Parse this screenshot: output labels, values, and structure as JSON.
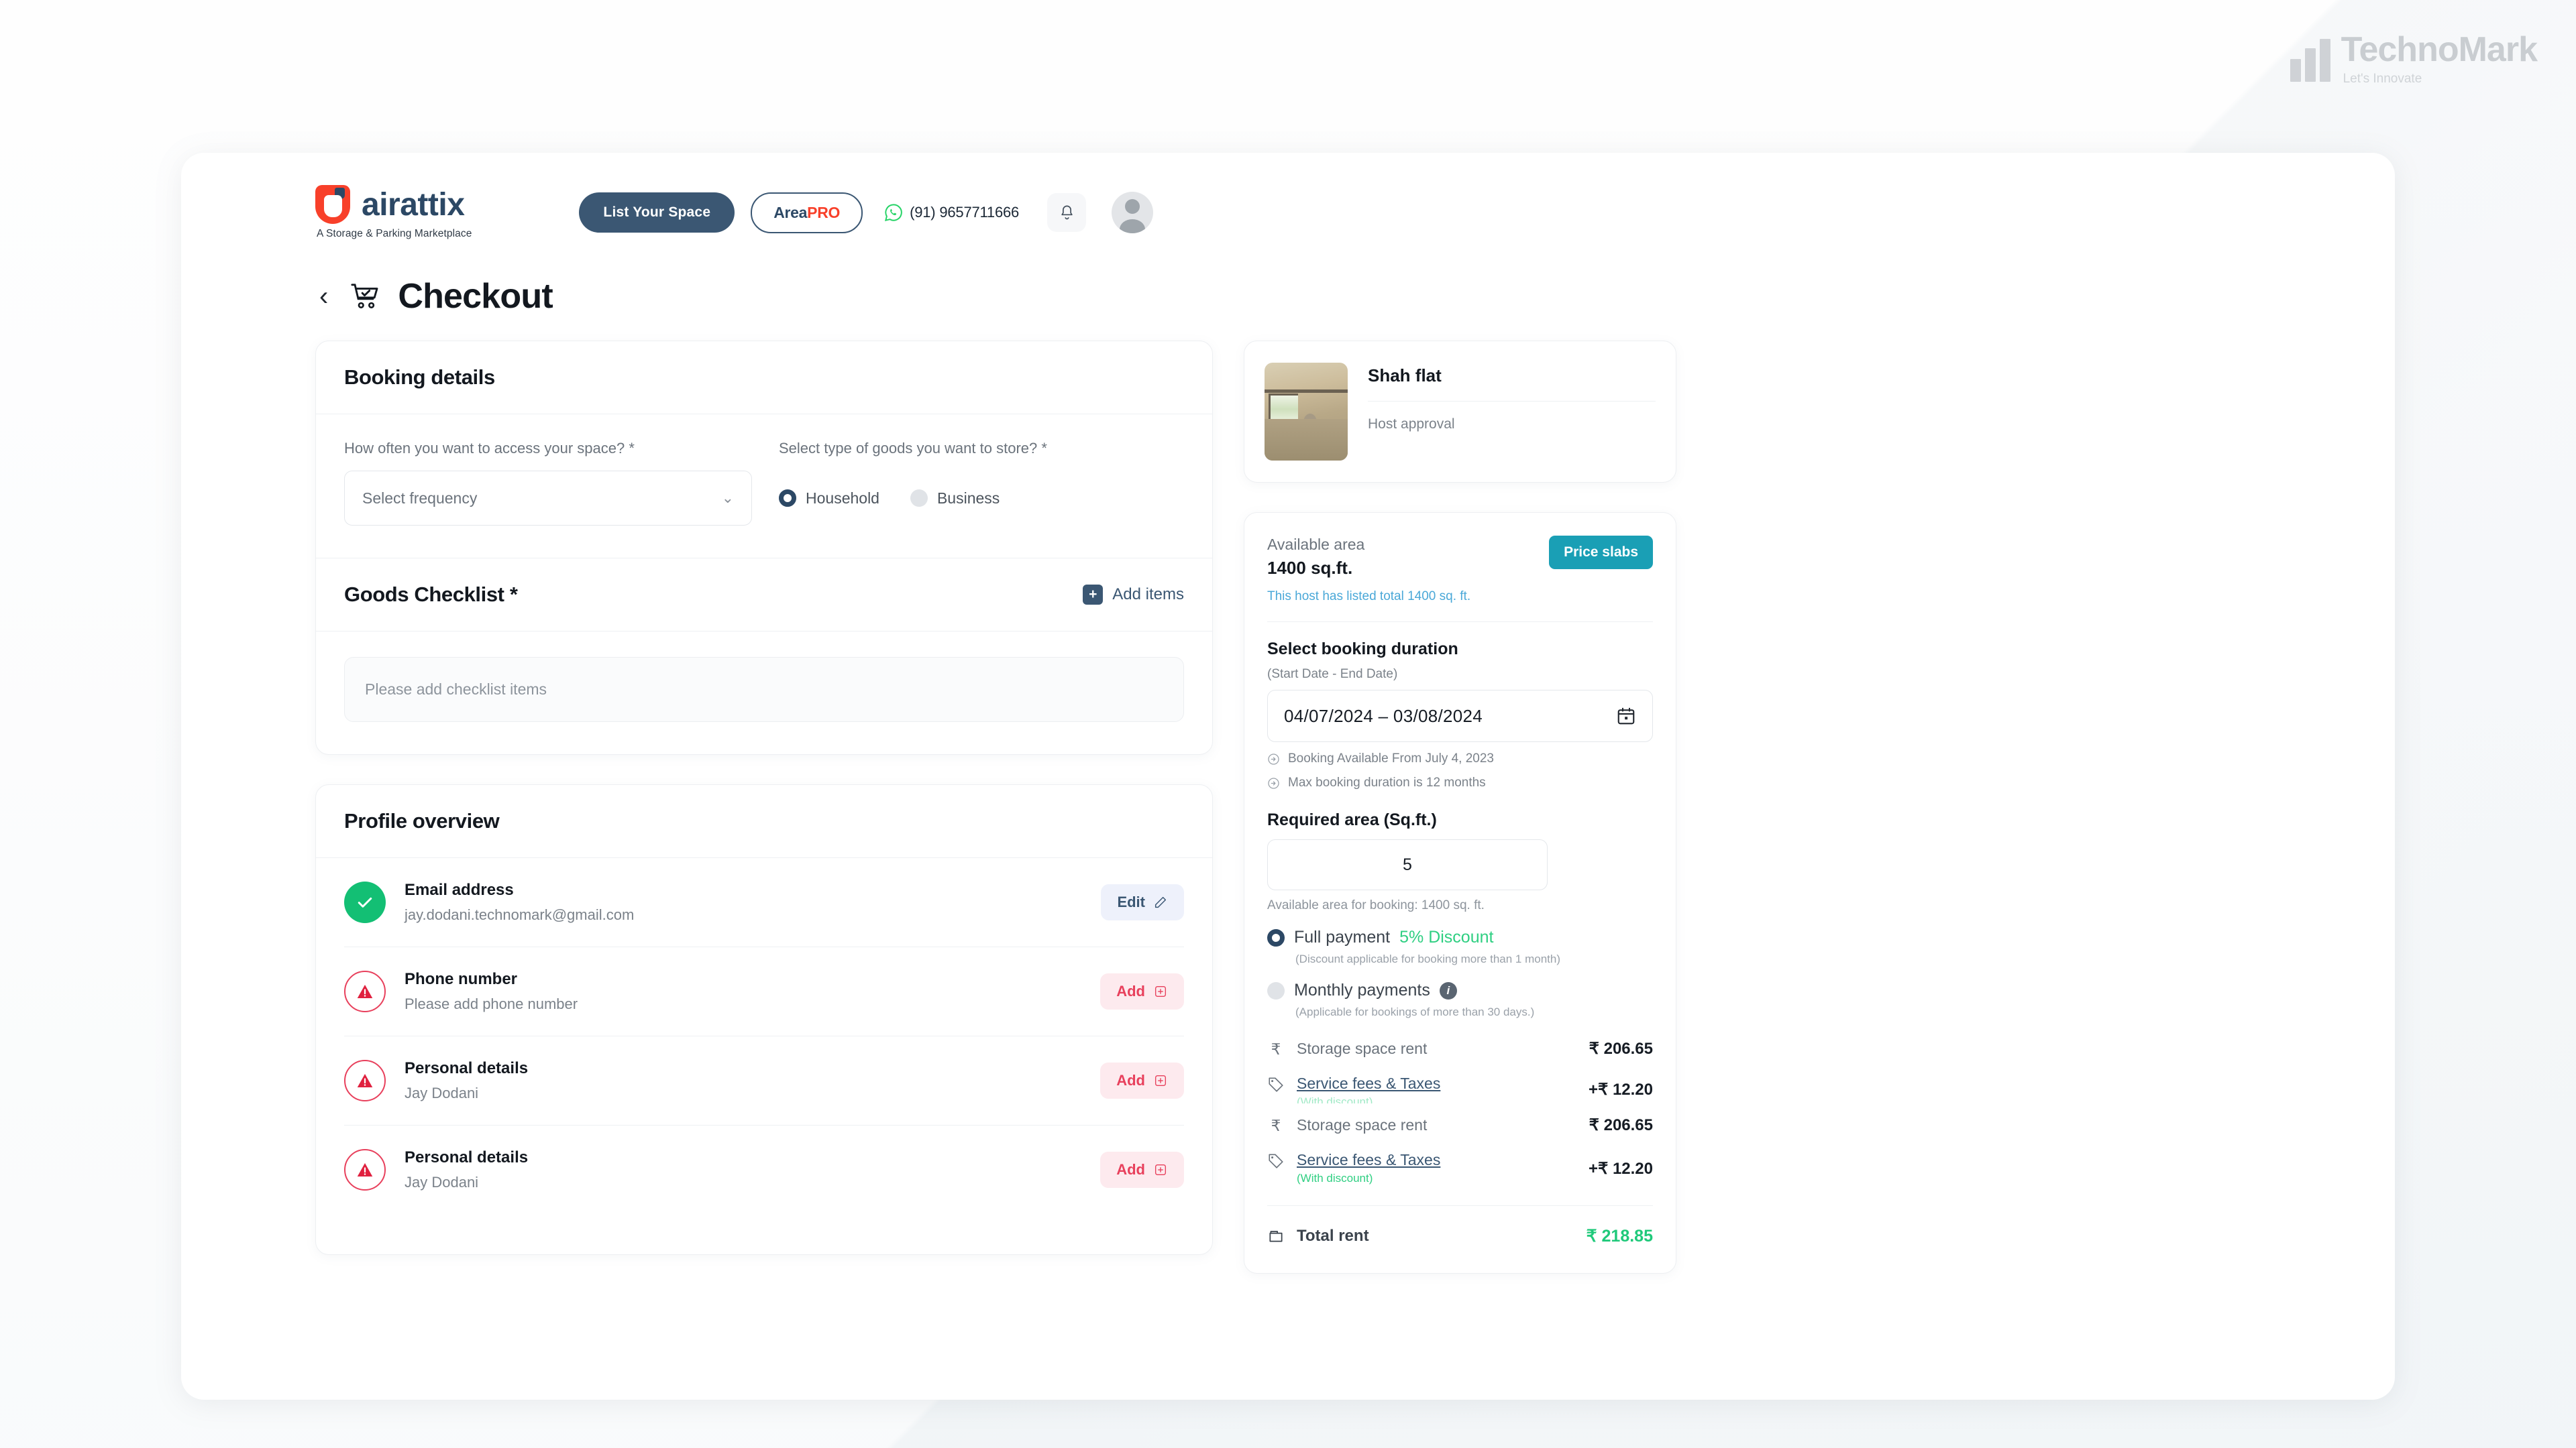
{
  "watermark": {
    "name": "TechnoMark",
    "tagline": "Let's Innovate"
  },
  "header": {
    "brand_name": "airattix",
    "brand_tagline": "A Storage & Parking Marketplace",
    "list_space_label": "List Your Space",
    "areapro_part1": "Area",
    "areapro_part2": "PRO",
    "phone": "(91) 9657711666",
    "whatsapp_icon": "whatsapp-icon",
    "bell_icon": "notification-bell-icon",
    "avatar_icon": "user-avatar-icon"
  },
  "page": {
    "back_icon": "back-chevron-icon",
    "cart_icon": "shopping-cart-check-icon",
    "title": "Checkout"
  },
  "booking_details": {
    "card_title": "Booking details",
    "frequency_label": "How often you want to access your space? *",
    "frequency_value": "Select frequency",
    "goods_type_label": "Select type of goods you want to store? *",
    "goods_options": [
      {
        "label": "Household",
        "selected": true
      },
      {
        "label": "Business",
        "selected": false
      }
    ]
  },
  "goods_checklist": {
    "card_title": "Goods Checklist *",
    "add_items_label": "Add items",
    "add_icon": "plus-square-icon",
    "empty_text": "Please add checklist items"
  },
  "profile_overview": {
    "card_title": "Profile overview",
    "rows": [
      {
        "status": "ok",
        "status_icon": "check-circle-icon",
        "title": "Email address",
        "subtitle": "jay.dodani.technomark@gmail.com",
        "action_label": "Edit",
        "action_icon": "pencil-edit-icon",
        "action_kind": "edit"
      },
      {
        "status": "warn",
        "status_icon": "warning-triangle-icon",
        "title": "Phone number",
        "subtitle": "Please add phone number",
        "action_label": "Add",
        "action_icon": "plus-square-icon",
        "action_kind": "add"
      },
      {
        "status": "warn",
        "status_icon": "warning-triangle-icon",
        "title": "Personal details",
        "subtitle": "Jay Dodani",
        "action_label": "Add",
        "action_icon": "plus-square-icon",
        "action_kind": "add"
      },
      {
        "status": "warn",
        "status_icon": "warning-triangle-icon",
        "title": "Personal details",
        "subtitle": "Jay Dodani",
        "action_label": "Add",
        "action_icon": "plus-square-icon",
        "action_kind": "add"
      }
    ]
  },
  "space_card": {
    "name": "Shah flat",
    "status": "Host approval",
    "thumb_alt": "space-photo"
  },
  "summary": {
    "available_area_label": "Available area",
    "available_area_value": "1400 sq.ft.",
    "price_slabs_label": "Price slabs",
    "host_note": "This host has listed total 1400 sq. ft.",
    "duration_title": "Select booking duration",
    "duration_sub": "(Start Date - End Date)",
    "duration_value": "04/07/2024 – 03/08/2024",
    "calendar_icon": "calendar-icon",
    "hints": [
      "Booking Available From July 4, 2023",
      "Max booking duration is 12 months"
    ],
    "required_area_title": "Required area (Sq.ft.)",
    "required_area_value": "5",
    "required_area_note": "Available area for booking: 1400 sq. ft.",
    "payment_options": [
      {
        "label": "Full payment",
        "discount": "5% Discount",
        "note": "(Discount applicable for booking more than 1 month)",
        "selected": true
      },
      {
        "label": "Monthly payments",
        "info_icon": "info-icon",
        "note": "(Applicable for bookings of more than 30 days.)",
        "selected": false
      }
    ],
    "price_rows": [
      {
        "icon": "rupee-icon",
        "name": "Storage space rent",
        "amount": "₹ 206.65",
        "link": false
      },
      {
        "icon": "tag-icon",
        "name": "Service fees & Taxes",
        "amount": "+₹ 12.20",
        "link": true,
        "sub": "(With discount)"
      },
      {
        "icon": "rupee-icon",
        "name": "Storage space rent",
        "amount": "₹ 206.65",
        "link": false
      },
      {
        "icon": "tag-icon",
        "name": "Service fees & Taxes",
        "amount": "+₹ 12.20",
        "link": true,
        "sub": "(With discount)"
      }
    ],
    "total_icon": "wallet-icon",
    "total_label": "Total rent",
    "total_amount": "₹ 218.85"
  },
  "colors": {
    "brand_navy": "#2c4865",
    "brand_red": "#f8402a",
    "accent_teal": "#1a9fb5",
    "success_green": "#13bf74",
    "total_green": "#1fc97a",
    "warn_red": "#e8405c",
    "link_blue": "#4aa8d8"
  }
}
